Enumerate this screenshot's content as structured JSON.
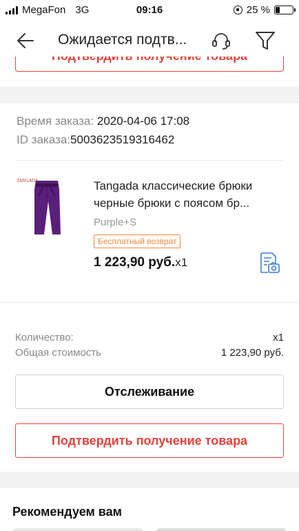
{
  "status_bar": {
    "carrier": "MegaFon",
    "network": "3G",
    "time": "09:16",
    "battery_text": "25 %",
    "battery_level": 0.25
  },
  "nav": {
    "title": "Ожидается подтв...",
    "back_icon": "arrow-left-icon",
    "support_icon": "headset-icon",
    "filter_icon": "filter-icon"
  },
  "top_peek_button": {
    "label": "Подтвердить получение товара"
  },
  "order": {
    "time_label": "Время заказа: ",
    "time_value": "2020-04-06 17:08",
    "id_label": "ID заказа:",
    "id_value": "5003623519316462"
  },
  "product": {
    "image_brand": "TANGADA",
    "title_line1": "Tangada классические брюки",
    "title_line2": "черные  брюки с поясом бр...",
    "sku": "Purple+S",
    "tag": "Бесплатный возврат",
    "price": "1 223,90 руб.",
    "qty": "x1",
    "doc_icon": "document-photo-icon"
  },
  "summary": {
    "qty_label": "Количество:",
    "qty_value": "x1",
    "total_label": "Общая стоимость",
    "total_value": "1 223,90 руб."
  },
  "buttons": {
    "track": "Отслеживание",
    "confirm": "Подтвердить получение товара"
  },
  "recommend": {
    "title": "Рекомендуем вам"
  },
  "colors": {
    "accent": "#e4433b",
    "tag": "#f08a3c",
    "doc_icon": "#3a7fd5",
    "divider": "#f2f2f2"
  }
}
